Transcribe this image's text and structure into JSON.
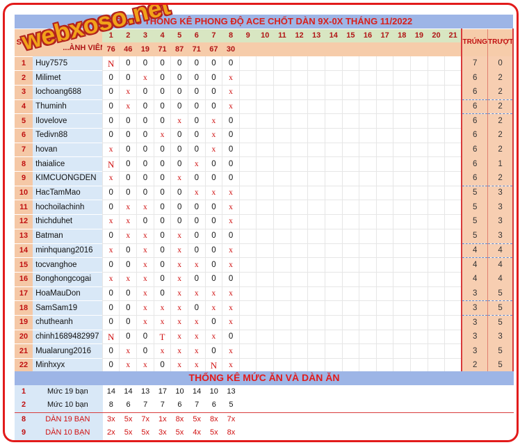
{
  "title": "BẢNG THỐNG KÊ PHONG ĐỘ ACE CHỐT DÀN 9X-0X THÁNG 11/2022",
  "logo_text": "webxoso.net",
  "header": {
    "stt": "STT",
    "member": "THÀNH VIÊN",
    "member_visible": "...ÀNH VIÊN",
    "trung": "TRÚNG",
    "truot": "TRƯỢT"
  },
  "days": [
    "1",
    "2",
    "3",
    "4",
    "5",
    "6",
    "7",
    "8",
    "9",
    "10",
    "11",
    "12",
    "13",
    "14",
    "15",
    "16",
    "17",
    "18",
    "19",
    "20",
    "21"
  ],
  "results": [
    "76",
    "46",
    "19",
    "71",
    "87",
    "71",
    "67",
    "30"
  ],
  "rows": [
    {
      "stt": "1",
      "name": "Huy7575",
      "marks": [
        "N",
        "0",
        "0",
        "0",
        "0",
        "0",
        "0",
        "0"
      ],
      "trung": "7",
      "truot": "0"
    },
    {
      "stt": "2",
      "name": "Milimet",
      "marks": [
        "0",
        "0",
        "x",
        "0",
        "0",
        "0",
        "0",
        "x"
      ],
      "trung": "6",
      "truot": "2"
    },
    {
      "stt": "3",
      "name": "lochoang688",
      "marks": [
        "0",
        "x",
        "0",
        "0",
        "0",
        "0",
        "0",
        "x"
      ],
      "trung": "6",
      "truot": "2"
    },
    {
      "stt": "4",
      "name": "Thuminh",
      "marks": [
        "0",
        "x",
        "0",
        "0",
        "0",
        "0",
        "0",
        "x"
      ],
      "trung": "6",
      "truot": "2"
    },
    {
      "stt": "5",
      "name": "Ilovelove",
      "marks": [
        "0",
        "0",
        "0",
        "0",
        "x",
        "0",
        "x",
        "0"
      ],
      "trung": "6",
      "truot": "2"
    },
    {
      "stt": "6",
      "name": "Tedivn88",
      "marks": [
        "0",
        "0",
        "0",
        "x",
        "0",
        "0",
        "x",
        "0"
      ],
      "trung": "6",
      "truot": "2"
    },
    {
      "stt": "7",
      "name": "hovan",
      "marks": [
        "x",
        "0",
        "0",
        "0",
        "0",
        "0",
        "x",
        "0"
      ],
      "trung": "6",
      "truot": "2"
    },
    {
      "stt": "8",
      "name": "thaialice",
      "marks": [
        "N",
        "0",
        "0",
        "0",
        "0",
        "x",
        "0",
        "0"
      ],
      "trung": "6",
      "truot": "1"
    },
    {
      "stt": "9",
      "name": "KIMCUONGDEN",
      "marks": [
        "x",
        "0",
        "0",
        "0",
        "x",
        "0",
        "0",
        "0"
      ],
      "trung": "6",
      "truot": "2"
    },
    {
      "stt": "10",
      "name": "HacTamMao",
      "marks": [
        "0",
        "0",
        "0",
        "0",
        "0",
        "x",
        "x",
        "x"
      ],
      "trung": "5",
      "truot": "3"
    },
    {
      "stt": "11",
      "name": "hochoilachinh",
      "marks": [
        "0",
        "x",
        "x",
        "0",
        "0",
        "0",
        "0",
        "x"
      ],
      "trung": "5",
      "truot": "3"
    },
    {
      "stt": "12",
      "name": "thichduhet",
      "marks": [
        "x",
        "x",
        "0",
        "0",
        "0",
        "0",
        "0",
        "x"
      ],
      "trung": "5",
      "truot": "3"
    },
    {
      "stt": "13",
      "name": "Batman",
      "marks": [
        "0",
        "x",
        "x",
        "0",
        "x",
        "0",
        "0",
        "0"
      ],
      "trung": "5",
      "truot": "3"
    },
    {
      "stt": "14",
      "name": "minhquang2016",
      "marks": [
        "x",
        "0",
        "x",
        "0",
        "x",
        "0",
        "0",
        "x"
      ],
      "trung": "4",
      "truot": "4"
    },
    {
      "stt": "15",
      "name": "tocvanghoe",
      "marks": [
        "0",
        "0",
        "x",
        "0",
        "x",
        "x",
        "0",
        "x"
      ],
      "trung": "4",
      "truot": "4"
    },
    {
      "stt": "16",
      "name": "Bonghongcogai",
      "marks": [
        "x",
        "x",
        "x",
        "0",
        "x",
        "0",
        "0",
        "0"
      ],
      "trung": "4",
      "truot": "4"
    },
    {
      "stt": "17",
      "name": "HoaMauDon",
      "marks": [
        "0",
        "0",
        "x",
        "0",
        "x",
        "x",
        "x",
        "x"
      ],
      "trung": "3",
      "truot": "5"
    },
    {
      "stt": "18",
      "name": "SamSam19",
      "marks": [
        "0",
        "0",
        "x",
        "x",
        "x",
        "0",
        "x",
        "x"
      ],
      "trung": "3",
      "truot": "5"
    },
    {
      "stt": "19",
      "name": "chutheanh",
      "marks": [
        "0",
        "0",
        "x",
        "x",
        "x",
        "x",
        "0",
        "x"
      ],
      "trung": "3",
      "truot": "5"
    },
    {
      "stt": "20",
      "name": "chinh1689482997",
      "marks": [
        "N",
        "0",
        "0",
        "T",
        "x",
        "x",
        "x",
        "0"
      ],
      "trung": "3",
      "truot": "3"
    },
    {
      "stt": "21",
      "name": "Mualarung2016",
      "marks": [
        "0",
        "x",
        "0",
        "x",
        "x",
        "x",
        "0",
        "x"
      ],
      "trung": "3",
      "truot": "5"
    },
    {
      "stt": "22",
      "name": "Minhxyx",
      "marks": [
        "0",
        "x",
        "x",
        "0",
        "x",
        "x",
        "N",
        "x"
      ],
      "trung": "2",
      "truot": "5"
    }
  ],
  "summary": {
    "title": "THỐNG KÊ MỨC ĂN VÀ DÀN ĂN",
    "rows": [
      {
        "stt": "1",
        "label": "Mức 19 bạn",
        "values": [
          "14",
          "14",
          "13",
          "17",
          "10",
          "14",
          "10",
          "13"
        ],
        "red": false
      },
      {
        "stt": "2",
        "label": "Mức 10 bạn",
        "values": [
          "8",
          "6",
          "7",
          "7",
          "6",
          "7",
          "6",
          "5"
        ],
        "red": false
      },
      {
        "stt": "8",
        "label": "DÀN 19 BẠN",
        "values": [
          "3x",
          "5x",
          "7x",
          "1x",
          "8x",
          "5x",
          "8x",
          "7x"
        ],
        "red": true
      },
      {
        "stt": "9",
        "label": "DÀN 10 BẠN",
        "values": [
          "2x",
          "5x",
          "5x",
          "3x",
          "5x",
          "4x",
          "5x",
          "8x"
        ],
        "red": true
      }
    ]
  },
  "colors": {
    "title_bg": "#9db5e6",
    "title_text": "#d8201a",
    "stt_bg": "#f5c8a6",
    "name_bg": "#d9e8f7",
    "day_header_bg": "#d8e6c2",
    "miss_mark": "#d01010",
    "frame": "#e21b1b",
    "logo_fill": "#f1a21a"
  }
}
